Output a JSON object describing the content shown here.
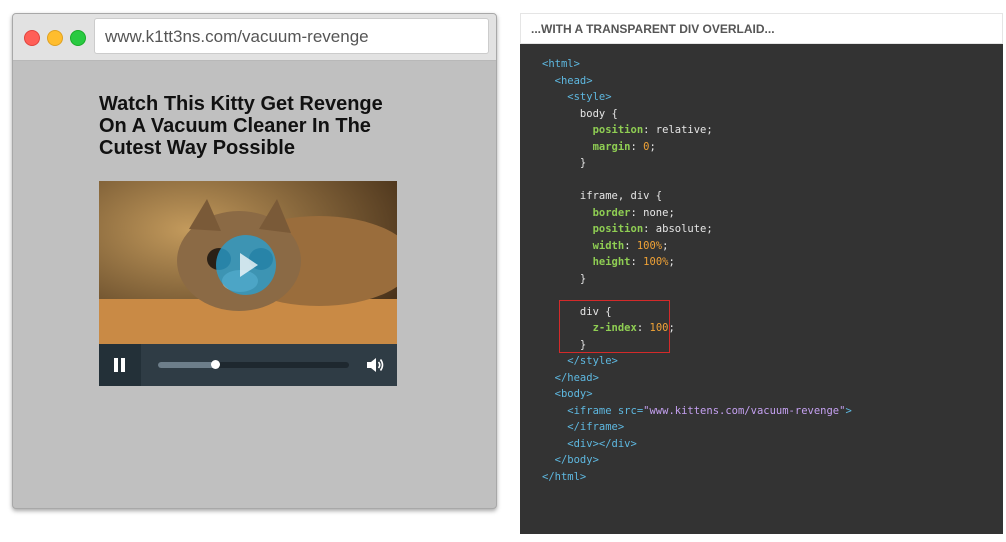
{
  "browser": {
    "url": "www.k1tt3ns.com/vacuum-revenge",
    "headline": "Watch This Kitty Get Revenge On A Vacuum Cleaner In The Cutest Way Possible",
    "video": {
      "progress_fraction": 0.3,
      "icons": {
        "play": "play-icon",
        "pause": "pause-icon",
        "volume": "volume-icon"
      }
    },
    "window_buttons": [
      "close",
      "minimize",
      "maximize"
    ]
  },
  "panel": {
    "header": "...WITH A TRANSPARENT DIV OVERLAID...",
    "code_lines": [
      [
        {
          "t": "tag",
          "v": "<html>"
        }
      ],
      [
        {
          "t": "tag",
          "v": "  <head>"
        }
      ],
      [
        {
          "t": "tag",
          "v": "    <style>"
        }
      ],
      [
        {
          "t": "plain",
          "v": "      body {"
        }
      ],
      [
        {
          "t": "plain",
          "v": "        "
        },
        {
          "t": "prop",
          "v": "position"
        },
        {
          "t": "plain",
          "v": ": relative;"
        }
      ],
      [
        {
          "t": "plain",
          "v": "        "
        },
        {
          "t": "prop",
          "v": "margin"
        },
        {
          "t": "plain",
          "v": ": "
        },
        {
          "t": "num",
          "v": "0"
        },
        {
          "t": "plain",
          "v": ";"
        }
      ],
      [
        {
          "t": "plain",
          "v": "      }"
        }
      ],
      [
        {
          "t": "plain",
          "v": ""
        }
      ],
      [
        {
          "t": "plain",
          "v": "      iframe, div {"
        }
      ],
      [
        {
          "t": "plain",
          "v": "        "
        },
        {
          "t": "prop",
          "v": "border"
        },
        {
          "t": "plain",
          "v": ": none;"
        }
      ],
      [
        {
          "t": "plain",
          "v": "        "
        },
        {
          "t": "prop",
          "v": "position"
        },
        {
          "t": "plain",
          "v": ": absolute;"
        }
      ],
      [
        {
          "t": "plain",
          "v": "        "
        },
        {
          "t": "prop",
          "v": "width"
        },
        {
          "t": "plain",
          "v": ": "
        },
        {
          "t": "num",
          "v": "100%"
        },
        {
          "t": "plain",
          "v": ";"
        }
      ],
      [
        {
          "t": "plain",
          "v": "        "
        },
        {
          "t": "prop",
          "v": "height"
        },
        {
          "t": "plain",
          "v": ": "
        },
        {
          "t": "num",
          "v": "100%"
        },
        {
          "t": "plain",
          "v": ";"
        }
      ],
      [
        {
          "t": "plain",
          "v": "      }"
        }
      ],
      [
        {
          "t": "plain",
          "v": ""
        }
      ],
      [
        {
          "t": "plain",
          "v": "      div {"
        }
      ],
      [
        {
          "t": "plain",
          "v": "        "
        },
        {
          "t": "prop",
          "v": "z-index"
        },
        {
          "t": "plain",
          "v": ": "
        },
        {
          "t": "num",
          "v": "100"
        },
        {
          "t": "plain",
          "v": ";"
        }
      ],
      [
        {
          "t": "plain",
          "v": "      }"
        }
      ],
      [
        {
          "t": "tag",
          "v": "    </style>"
        }
      ],
      [
        {
          "t": "tag",
          "v": "  </head>"
        }
      ],
      [
        {
          "t": "tag",
          "v": "  <body>"
        }
      ],
      [
        {
          "t": "tag",
          "v": "    <iframe "
        },
        {
          "t": "tag",
          "v": "src="
        },
        {
          "t": "str",
          "v": "\"www.kittens.com/vacuum-revenge\""
        },
        {
          "t": "tag",
          "v": ">"
        }
      ],
      [
        {
          "t": "tag",
          "v": "    </iframe>"
        }
      ],
      [
        {
          "t": "tag",
          "v": "    <div></div>"
        }
      ],
      [
        {
          "t": "tag",
          "v": "  </body>"
        }
      ],
      [
        {
          "t": "tag",
          "v": "</html>"
        }
      ]
    ],
    "colors": {
      "tag": "#5eb8e0",
      "property": "#8fce53",
      "number": "#f0a236",
      "string": "#c4a0f0",
      "highlight": "#d42a2a"
    }
  }
}
